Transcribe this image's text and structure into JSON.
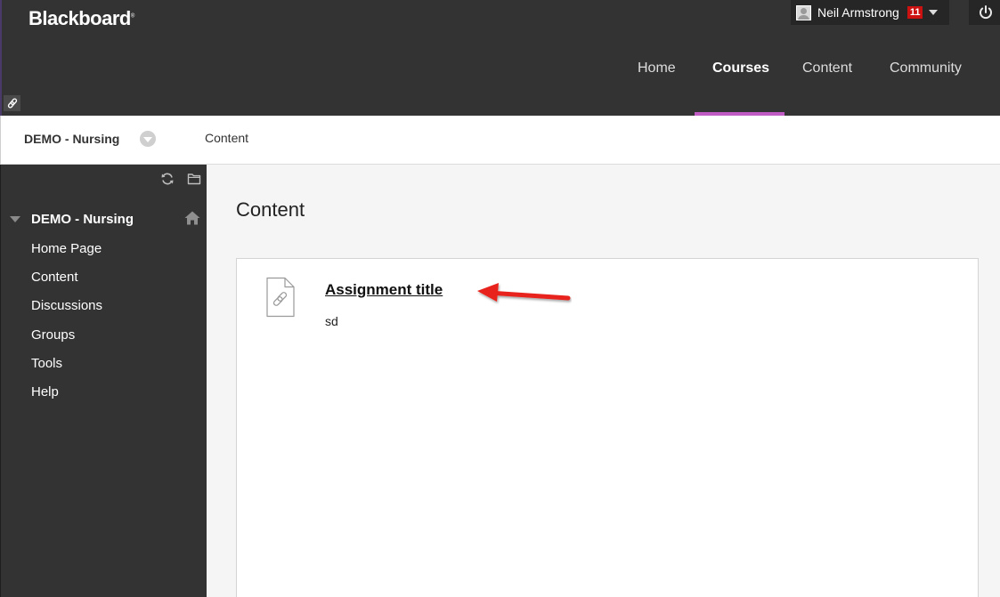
{
  "header": {
    "logo": "Blackboard",
    "logo_mark": "®",
    "user": {
      "name": "Neil Armstrong",
      "notifications": "11"
    },
    "tabs": [
      {
        "label": "Home",
        "active": false
      },
      {
        "label": "Courses",
        "active": true
      },
      {
        "label": "Content",
        "active": false
      },
      {
        "label": "Community",
        "active": false
      }
    ],
    "accent_color": "#c05cc4"
  },
  "breadcrumb": {
    "course": "DEMO - Nursing",
    "page": "Content"
  },
  "sidebar": {
    "course_title": "DEMO - Nursing",
    "items": [
      "Home Page",
      "Content",
      "Discussions",
      "Groups",
      "Tools",
      "Help"
    ],
    "icons": [
      "refresh-icon",
      "folder-icon",
      "home-icon",
      "collapse-triangle-icon"
    ]
  },
  "main": {
    "title": "Content",
    "item": {
      "title": "Assignment title",
      "description": "sd",
      "icon": "linked-file-icon"
    }
  },
  "annotation": {
    "type": "arrow",
    "color": "#e8221a"
  }
}
